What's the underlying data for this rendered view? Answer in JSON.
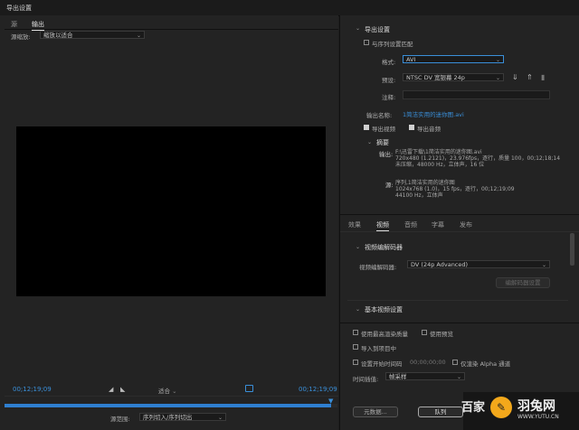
{
  "window": {
    "title": "导出设置"
  },
  "left": {
    "tabs": [
      "源",
      "输出"
    ],
    "scale_label": "源缩放:",
    "scale_value": "缩放以适合",
    "timecode_start": "00;12;19;09",
    "timecode_end": "00;12;19;09",
    "fit_value": "适合",
    "source_range_label": "源范围:",
    "source_range_value": "序列切入/序列切出"
  },
  "export": {
    "section_title": "导出设置",
    "match_sequence": "与序列设置匹配",
    "format_label": "格式:",
    "format_value": "AVI",
    "preset_label": "预设:",
    "preset_value": "NTSC DV 宽银幕 24p",
    "comments_label": "注释:",
    "output_name_label": "输出名称:",
    "output_name_value": "1简洁实用的迷你图.avi",
    "export_video": "导出视频",
    "export_audio": "导出音频",
    "summary_title": "摘要",
    "output_label": "输出:",
    "output_lines": [
      "F:\\迅雷下载\\1简洁实用的迷你图.avi",
      "720x480 (1.2121)，23.976fps，逐行，质量 100，00;12;18;14",
      "未压缩，48000 Hz，立体声，16 位"
    ],
    "source_label": "源:",
    "source_lines": [
      "序列,1简洁实用的迷你图",
      "1024x768 (1.0)，15 fps，逐行，00;12;19;09",
      "44100 Hz，立体声"
    ]
  },
  "subtabs": [
    "效果",
    "视频",
    "音频",
    "字幕",
    "发布"
  ],
  "video_codec": {
    "section_title": "视频编解码器",
    "codec_label": "视频编解码器:",
    "codec_value": "DV (24p Advanced)",
    "codec_settings_button": "编解码器设置"
  },
  "basic_video": {
    "section_title": "基本视频设置"
  },
  "options": {
    "max_render_quality": "使用最高渲染质量",
    "use_previews": "使用预览",
    "import_into_project": "导入到项目中",
    "set_start_timecode": "设置开始时间码",
    "start_timecode_value": "00;00;00;00",
    "render_alpha_only": "仅渲染 Alpha 通道",
    "time_interpolation_label": "时间插值:",
    "time_interpolation_value": "帧采样"
  },
  "buttons": {
    "metadata": "元数据...",
    "queue": "队列"
  },
  "watermark": {
    "text": "羽兔网",
    "url": "WWW.YUTU.CN",
    "partial": "百家"
  }
}
